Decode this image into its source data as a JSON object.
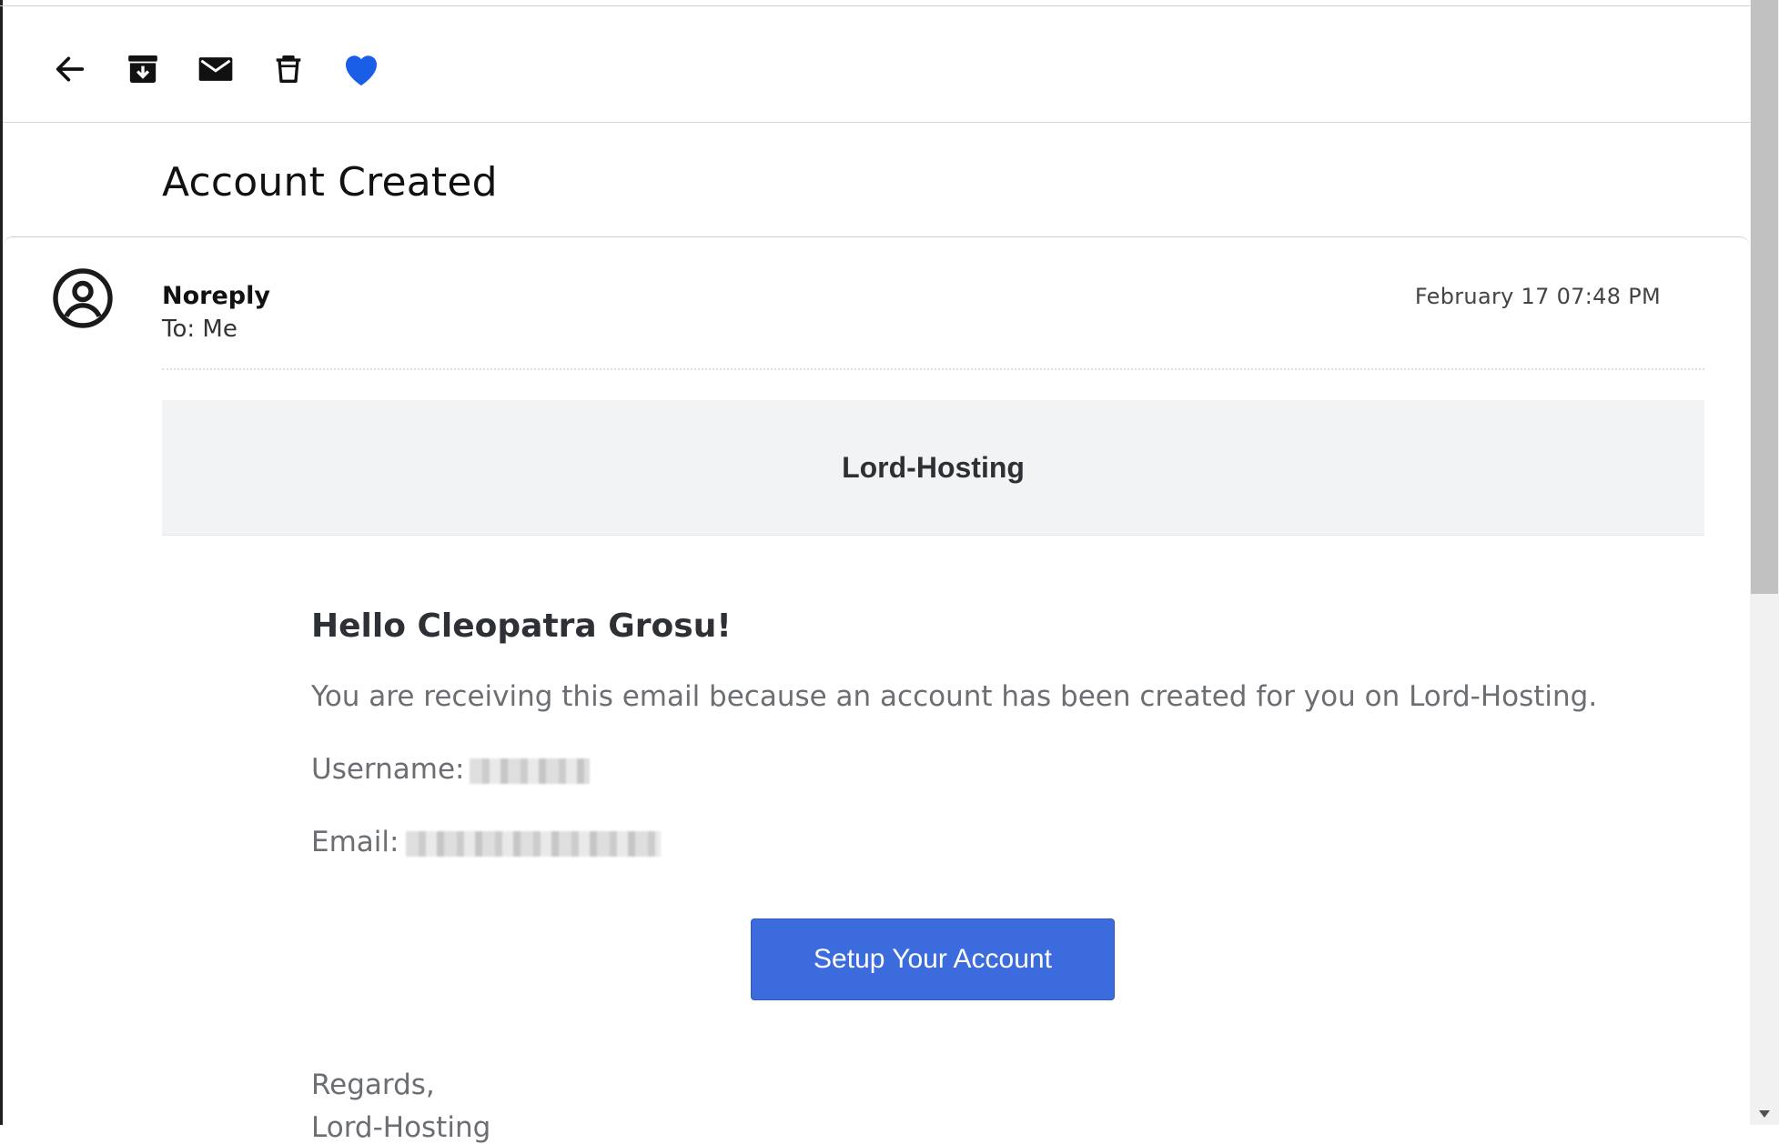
{
  "toolbar": {
    "back_icon": "arrow-left-icon",
    "archive_icon": "archive-icon",
    "mail_icon": "envelope-icon",
    "delete_icon": "trash-icon",
    "favorite_icon": "heart-icon",
    "favorite_color": "#1a5ee8"
  },
  "email": {
    "subject": "Account Created",
    "sender": "Noreply",
    "to": "To: Me",
    "date": "February 17 07:48 PM"
  },
  "body": {
    "brand": "Lord-Hosting",
    "greeting": "Hello Cleopatra Grosu!",
    "intro": "You are receiving this email because an account has been created for you on Lord-Hosting.",
    "username_label": "Username:",
    "email_label": "Email:",
    "cta_label": "Setup Your Account",
    "cta_color": "#3b6bdc",
    "regards": "Regards,",
    "signature": "Lord-Hosting"
  }
}
